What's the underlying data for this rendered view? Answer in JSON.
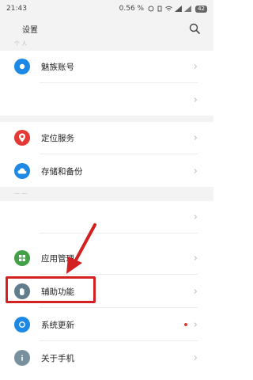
{
  "status_bar": {
    "time": "21:43",
    "speed": "0.56 %",
    "battery": "42"
  },
  "header": {
    "title": "设置"
  },
  "section_labels": {
    "top": "个 人",
    "middle": "— —"
  },
  "items": [
    {
      "label": "魅族账号",
      "icon": "user-icon",
      "color": "#1e88e5"
    },
    {
      "label": "",
      "icon": "",
      "color": ""
    },
    {
      "label": "定位服务",
      "icon": "location-pin-icon",
      "color": "#e53935"
    },
    {
      "label": "存储和备份",
      "icon": "cloud-icon",
      "color": "#1e88e5"
    },
    {
      "label": "",
      "icon": "",
      "color": ""
    },
    {
      "label": "应用管理",
      "icon": "apps-icon",
      "color": "#43a047"
    },
    {
      "label": "辅助功能",
      "icon": "hand-icon",
      "color": "#607d8b"
    },
    {
      "label": "系统更新",
      "icon": "update-icon",
      "color": "#1e88e5"
    },
    {
      "label": "关于手机",
      "icon": "info-icon",
      "color": "#78909c"
    }
  ]
}
